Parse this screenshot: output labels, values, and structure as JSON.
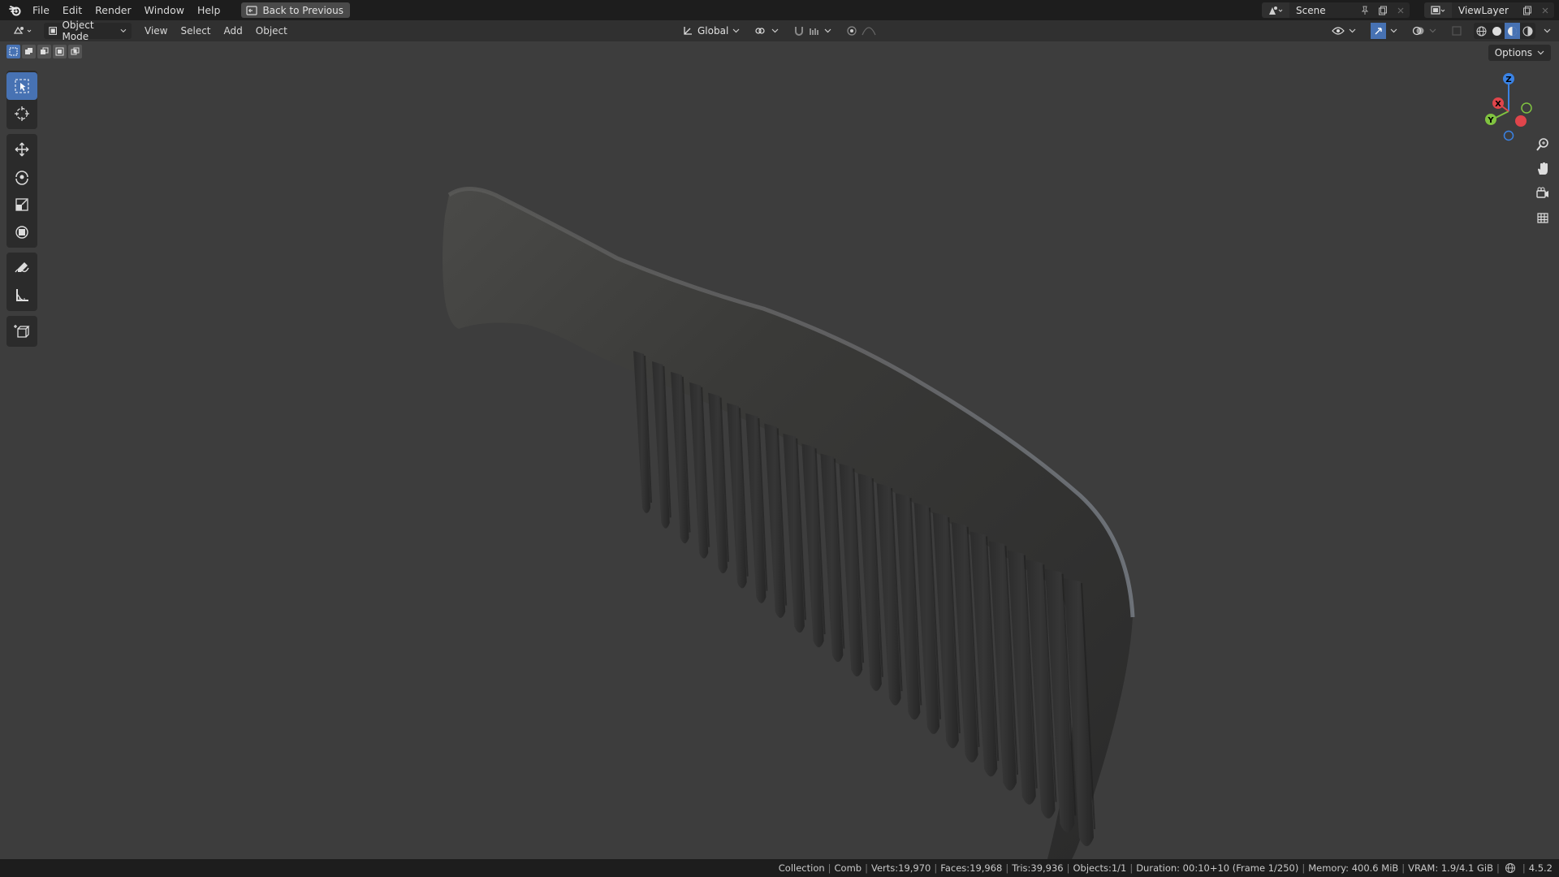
{
  "topbar": {
    "logo_icon": "blender-logo-icon",
    "menus": [
      "File",
      "Edit",
      "Render",
      "Window",
      "Help"
    ],
    "back_button": "Back to Previous",
    "scene_name": "Scene",
    "view_layer_name": "ViewLayer"
  },
  "header": {
    "mode": "Object Mode",
    "menus": [
      "View",
      "Select",
      "Add",
      "Object"
    ],
    "transform_orientation": "Global"
  },
  "viewport": {
    "options_label": "Options",
    "gizmo_axes": {
      "x": "X",
      "y": "Y",
      "z": "Z"
    },
    "colors": {
      "background": "#3d3d3d",
      "active_tool": "#4772b3",
      "x_axis": "#e0454b",
      "y_axis": "#80c340",
      "z_axis": "#3a82e4"
    }
  },
  "statusbar": {
    "collection": "Collection",
    "object": "Comb",
    "verts": "Verts:19,970",
    "faces": "Faces:19,968",
    "tris": "Tris:39,936",
    "objects": "Objects:1/1",
    "duration": "Duration: 00:10+10 (Frame 1/250)",
    "memory": "Memory: 400.6 MiB",
    "vram": "VRAM: 1.9/4.1 GiB",
    "version": "4.5.2"
  }
}
